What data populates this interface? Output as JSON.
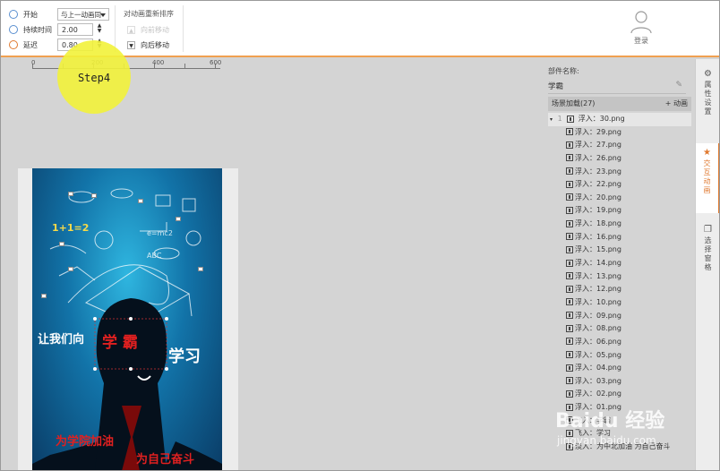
{
  "toolbar": {
    "start_label": "开始",
    "start_value": "与上一动画同",
    "duration_label": "持续时间",
    "duration_value": "2.00",
    "delay_label": "延迟",
    "delay_value": "0.80",
    "reorder_title": "对动画重新排序",
    "move_forward": "向前移动",
    "move_backward": "向后移动",
    "login": "登录"
  },
  "ruler": {
    "labels": [
      "0",
      "200",
      "400",
      "600"
    ]
  },
  "step_label": "Step4",
  "poster": {
    "line1": "让我们向",
    "line1_red": "学 霸",
    "line1_end": "学习",
    "line2": "为学院加油",
    "line3": "为自己奋斗"
  },
  "right_panel": {
    "component_name_label": "部件名称:",
    "component_name_value": "学霸",
    "scene_label": "场景加载(27)",
    "add_animation": "+ 动画",
    "first_index": "1",
    "items": [
      "浮入：30.png",
      "浮入：29.png",
      "浮入：27.png",
      "浮入：26.png",
      "浮入：23.png",
      "浮入：22.png",
      "浮入：20.png",
      "浮入：19.png",
      "浮入：18.png",
      "浮入：16.png",
      "浮入：15.png",
      "浮入：14.png",
      "浮入：13.png",
      "浮入：12.png",
      "浮入：10.png",
      "浮入：09.png",
      "浮入：08.png",
      "浮入：06.png",
      "浮入：05.png",
      "浮入：04.png",
      "浮入：03.png",
      "浮入：02.png",
      "浮入：01.png",
      "飞入：学霸",
      "飞入：学习",
      "淡入：为中北加油 为自己奋斗"
    ]
  },
  "side_tabs": {
    "properties": "属性设置",
    "interactive": "交互动画",
    "pane": "选择窗格"
  },
  "watermark": {
    "main": "Baidu 经验",
    "sub": "jingyan.baidu.com"
  }
}
